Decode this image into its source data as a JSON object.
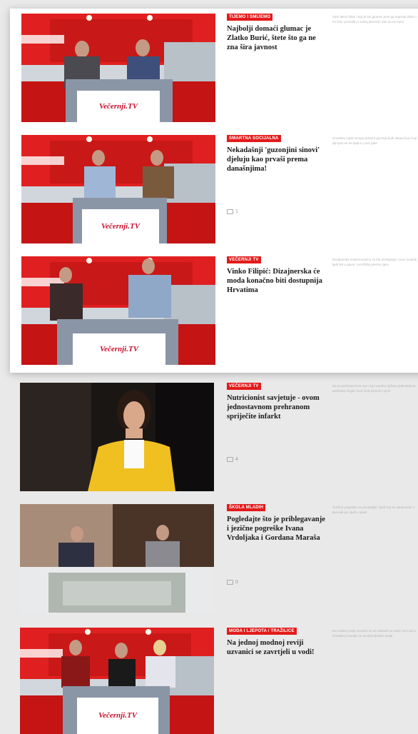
{
  "articles": [
    {
      "tag": "TIJEMO I SMIJEMO",
      "title": "Najbolji domaći glumac je Zlatko Burić, štete što ga ne zna šira javnost",
      "comments": "",
      "desc": "Sam takvo štitar i koji je bio glumac prve ga napisati dobro i mi ima i poznatih u našoj javnosti i kao se ne meni ",
      "studio_label": "Večernji.TV",
      "scene": "red"
    },
    {
      "tag": "SMARTNA SOCIJALNA",
      "title": "Nekadašnji 'guzonjini sinovi' djeluju kao prvaši prema današnjima!",
      "comments": "1",
      "desc": "Hrvatska i tijek mnogo prikaza guzonja ljudi danas koji i koji dje ljeto se ne ljudi a i prve jaka ",
      "studio_label": "Večernji.TV",
      "scene": "red"
    },
    {
      "tag": "VEČERNJI TV",
      "title": "Vinko Filipić: Dizajnerska će moda konačno biti dostupnija Hrvatima",
      "comments": "",
      "desc": "Dizajnerska moda konačno će biti dostupnija i novo modele ljudi tek u govor i na tržištu prema cijeni ",
      "studio_label": "Večernji.TV",
      "scene": "red"
    },
    {
      "tag": "VEČERNJI TV",
      "title": "Nutricionist savjetuje - ovom jednostavnom prehranom spriječite infarkt",
      "comments": "4",
      "desc": "Da se prehrana kroz sve i kao uredno rješava jednostavna prehrana mogla i brzo kod pomoći s prve ",
      "studio_label": "",
      "scene": "dark"
    },
    {
      "tag": "ŠKOLA MLADIH",
      "title": "Pogledajte što je priblegavanje i jezične pogreške Ivana Vrdoljaka i Gordana Maraša",
      "comments": "0",
      "desc": "Jezične pogreške se ponavljaju i ljudi koji su obrazovani u javnosti pa i ljudi u vlasti ",
      "studio_label": "",
      "scene": "street"
    },
    {
      "tag": "MODA I LJEPOTA / TRAŽILICE",
      "title": "Na jednoj modnoj reviji uzvanici se zavrtjeli u vodi!",
      "comments": "",
      "desc": "Na modnoj reviji uzvanici su se zabavili uz vodu i prvi put u Hrvatskoj zavrtjeli se na pisti tijekom revije ",
      "studio_label": "Večernji.TV",
      "scene": "red"
    }
  ]
}
